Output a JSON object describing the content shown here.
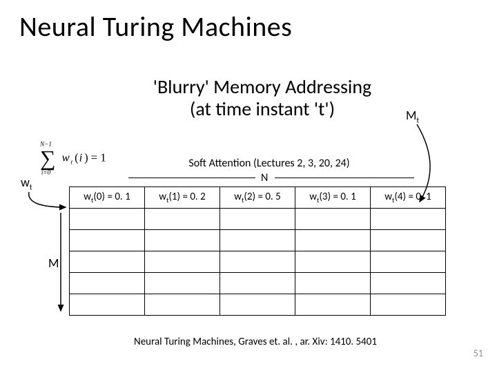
{
  "title": "Neural Turing Machines",
  "subtitle_line1": "'Blurry' Memory Addressing",
  "subtitle_line2": "(at time instant 't')",
  "mt_label_html": "M<sub>t</sub>",
  "wt_label_html": "w<sub>t</sub>",
  "soft_attention": "Soft Attention (Lectures 2, 3, 20, 24)",
  "n_label": "N",
  "m_label": "M",
  "weights_row": [
    "w<sub>t</sub>(0) = 0. 1",
    "w<sub>t</sub>(1) = 0. 2",
    "w<sub>t</sub>(2) = 0. 5",
    "w<sub>t</sub>(3) = 0. 1",
    "w<sub>t</sub>(4) = 0. 1"
  ],
  "citation": "Neural Turing Machines, Graves et. al. , ar. Xiv: 1410. 5401",
  "page_number": "51",
  "chart_data": {
    "type": "table",
    "description": "Blurry memory addressing weight vector w_t over N=5 memory locations; sums to 1; memory matrix M_t has M rows below",
    "columns": [
      "w_t(0)",
      "w_t(1)",
      "w_t(2)",
      "w_t(3)",
      "w_t(4)"
    ],
    "values": [
      0.1,
      0.2,
      0.5,
      0.1,
      0.1
    ],
    "N": 5,
    "M_rows_shown": 5,
    "constraint": "sum_{i=0}^{N-1} w_t(i) = 1"
  }
}
